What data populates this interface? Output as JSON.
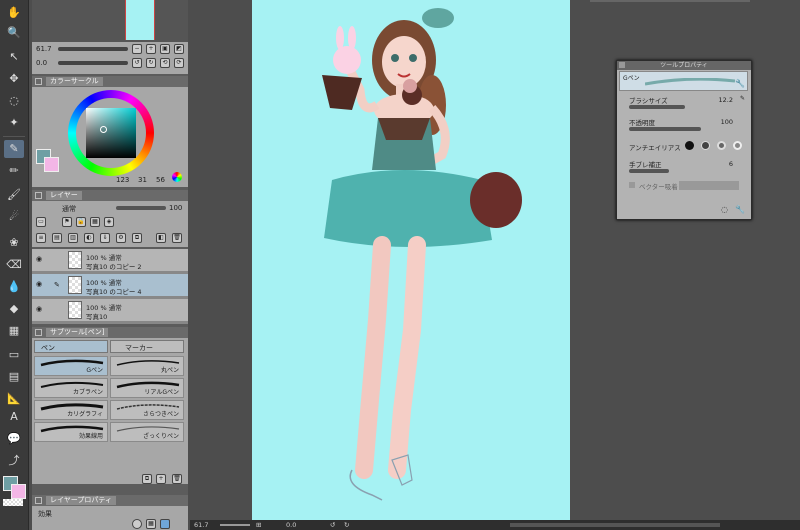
{
  "nav": {
    "zoom": "61.7",
    "zoom2": "0.0"
  },
  "color_panel": {
    "tab": "カラーサークル",
    "h": "123",
    "s": "31",
    "v": "56"
  },
  "layer_panel": {
    "tab": "レイヤー",
    "blend_mode": "通常",
    "opacity": "100",
    "layers": [
      {
        "mode": "100 % 通常",
        "name": "写真10 のコピー 2",
        "selected": false
      },
      {
        "mode": "100 % 通常",
        "name": "写真10 のコピー 4",
        "selected": true
      },
      {
        "mode": "100 % 通常",
        "name": "写真10",
        "selected": false
      }
    ]
  },
  "subtool_panel": {
    "tab": "サブツール[ペン]",
    "groups": [
      "ペン",
      "マーカー"
    ],
    "brushes": [
      "Gペン",
      "丸ペン",
      "カブラペン",
      "リアルGペン",
      "カリグラフィ",
      "さらつきペン",
      "効果線用",
      "ざっくりペン"
    ]
  },
  "layer_prop_panel": {
    "tab": "レイヤープロパティ",
    "effect_label": "効果"
  },
  "tool_property": {
    "title": "ツールプロパティ",
    "tool_name": "Gペン",
    "brush_size_label": "ブラシサイズ",
    "brush_size": "12.2",
    "opacity_label": "不透明度",
    "opacity": "100",
    "antialias_label": "アンチエイリアス",
    "stabilization_label": "手ブレ補正",
    "stabilization": "6",
    "vector_label": "ベクター吸着"
  },
  "statusbar": {
    "zoom": "61.7",
    "zoom2": "0.0"
  },
  "colors": {
    "canvas_bg": "#a6f2f3",
    "accent": "#5a6f86",
    "main_color": "#6f9fa4",
    "sub_color": "#f3b6e6"
  }
}
